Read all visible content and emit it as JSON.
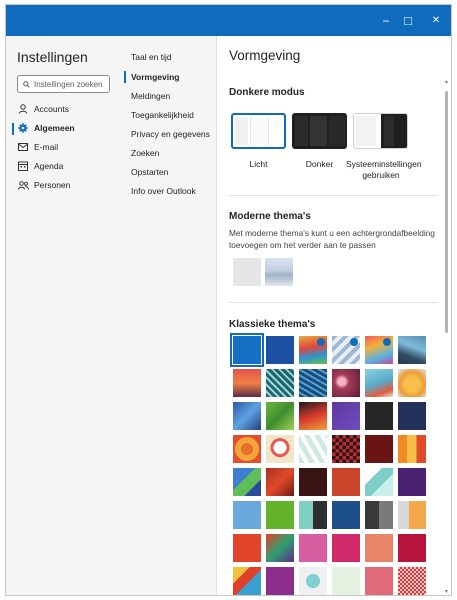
{
  "window": {
    "minimize_glyph": "−",
    "maximize_glyph": "□",
    "close_glyph": "✕",
    "titlebar_color": "#0f6cbd"
  },
  "sidebar": {
    "title": "Instellingen",
    "search_placeholder": "Instellingen zoeken",
    "items": [
      {
        "label": "Accounts",
        "icon": "person-icon"
      },
      {
        "label": "Algemeen",
        "icon": "gear-icon",
        "selected": true
      },
      {
        "label": "E-mail",
        "icon": "mail-icon"
      },
      {
        "label": "Agenda",
        "icon": "calendar-icon"
      },
      {
        "label": "Personen",
        "icon": "people-icon"
      }
    ]
  },
  "subnav": {
    "items": [
      {
        "label": "Taal en tijd"
      },
      {
        "label": "Vormgeving",
        "selected": true
      },
      {
        "label": "Meldingen"
      },
      {
        "label": "Toegankelijkheid"
      },
      {
        "label": "Privacy en gegevens"
      },
      {
        "label": "Zoeken"
      },
      {
        "label": "Opstarten"
      },
      {
        "label": "Info over Outlook"
      }
    ]
  },
  "content": {
    "title": "Vormgeving",
    "dark_mode": {
      "title": "Donkere modus",
      "options": [
        {
          "label": "Licht",
          "selected": true
        },
        {
          "label": "Donker"
        },
        {
          "label": "Systeeminstellingen gebruiken"
        }
      ]
    },
    "modern_themes": {
      "title": "Moderne thema's",
      "description": "Met moderne thema's kunt u een achtergrondafbeelding toevoegen om het verder aan te passen"
    },
    "classic_themes": {
      "title": "Klassieke thema's"
    }
  }
}
